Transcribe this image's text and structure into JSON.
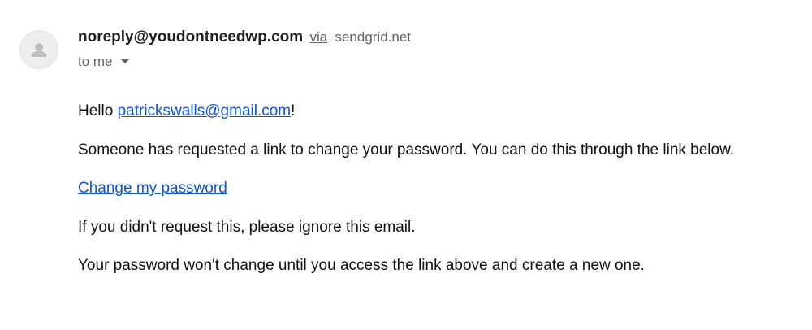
{
  "email": {
    "sender": {
      "address": "noreply@youdontneedwp.com",
      "via_label": "via",
      "via_domain": "sendgrid.net"
    },
    "recipient_label": "to me",
    "body": {
      "greeting_prefix": "Hello ",
      "greeting_email": "patrickswalls@gmail.com",
      "greeting_suffix": "!",
      "line_request": "Someone has requested a link to change your password. You can do this through the link below.",
      "change_link_label": "Change my password",
      "line_ignore": "If you didn't request this, please ignore this email.",
      "line_unchanged": "Your password won't change until you access the link above and create a new one."
    }
  },
  "icons": {
    "avatar": "person-icon",
    "recipient_dropdown": "caret-down-icon"
  },
  "colors": {
    "link": "#1155cc",
    "secondary_text": "#5f6368",
    "avatar_background": "#eeeeee",
    "avatar_glyph": "#bdbdbd"
  }
}
